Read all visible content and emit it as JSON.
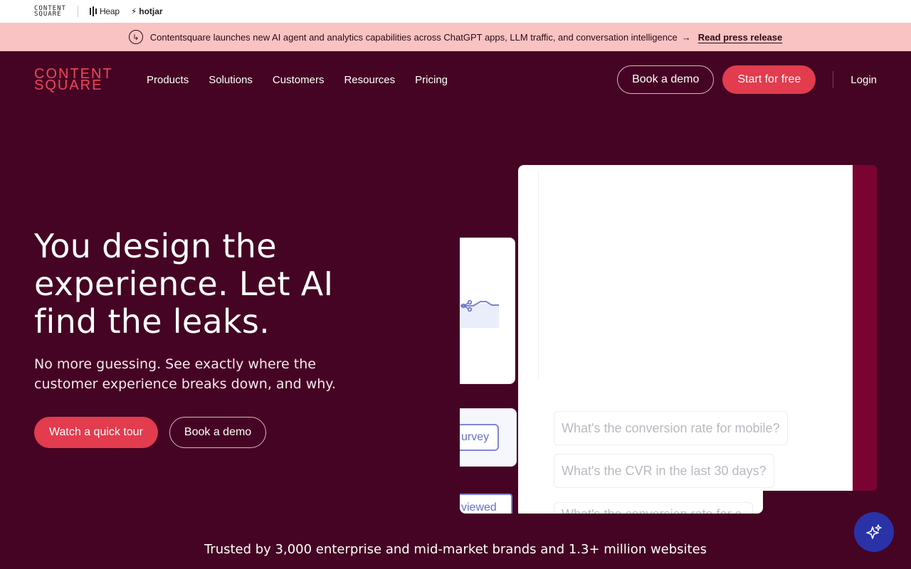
{
  "brandbar": {
    "cs_line1": "CONTENT",
    "cs_line2": "SQUARE",
    "heap": "Heap",
    "hotjar": "hotjar"
  },
  "announcement": {
    "text": "Contentsquare launches new AI agent and analytics capabilities across ChatGPT apps, LLM traffic, and conversation intelligence",
    "arrow": "→",
    "link": "Read press release"
  },
  "nav": {
    "logo_line1": "CONTENT",
    "logo_line2": "SQUARE",
    "links": [
      "Products",
      "Solutions",
      "Customers",
      "Resources",
      "Pricing"
    ],
    "book_demo": "Book a demo",
    "start_free": "Start for free",
    "login": "Login"
  },
  "hero": {
    "title": "You design the experience. Let AI find the leaks.",
    "subtitle": "No more guessing. See exactly where the customer experience breaks down, and why.",
    "cta_primary": "Watch a quick tour",
    "cta_secondary": "Book a demo"
  },
  "visual": {
    "pill_survey": "urvey",
    "pill_viewed": "viewed",
    "questions": [
      "What's the conversion rate for mobile?",
      "What's the CVR in the last 30 days?",
      "What's the conversion rate for c"
    ]
  },
  "trusted": "Trusted by 3,000 enterprise and mid-market brands and 1.3+ million websites",
  "colors": {
    "background": "#450423",
    "accent": "#e23c4e",
    "announce_bg": "#f9c3c3",
    "fab": "#2a32a8"
  }
}
